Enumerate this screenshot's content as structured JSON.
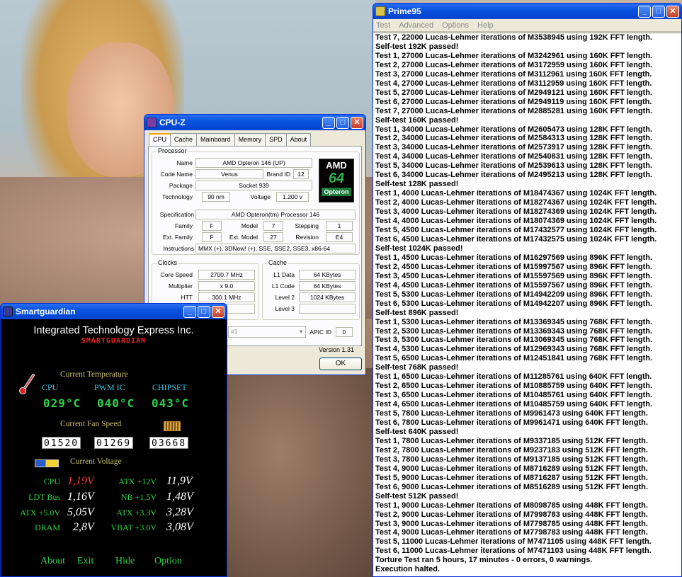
{
  "prime95": {
    "title": "Prime95",
    "menu": [
      "Test",
      "Advanced",
      "Options",
      "Help"
    ],
    "lines": [
      "Test 7, 22000 Lucas-Lehmer iterations of M3538945 using 192K FFT length.",
      "Self-test 192K passed!",
      "Test 1, 27000 Lucas-Lehmer iterations of M3242961 using 160K FFT length.",
      "Test 2, 27000 Lucas-Lehmer iterations of M3172959 using 160K FFT length.",
      "Test 3, 27000 Lucas-Lehmer iterations of M3112961 using 160K FFT length.",
      "Test 4, 27000 Lucas-Lehmer iterations of M3112959 using 160K FFT length.",
      "Test 5, 27000 Lucas-Lehmer iterations of M2949121 using 160K FFT length.",
      "Test 6, 27000 Lucas-Lehmer iterations of M2949119 using 160K FFT length.",
      "Test 7, 27000 Lucas-Lehmer iterations of M2885281 using 160K FFT length.",
      "Self-test 160K passed!",
      "Test 1, 34000 Lucas-Lehmer iterations of M2605473 using 128K FFT length.",
      "Test 2, 34000 Lucas-Lehmer iterations of M2584313 using 128K FFT length.",
      "Test 3, 34000 Lucas-Lehmer iterations of M2573917 using 128K FFT length.",
      "Test 4, 34000 Lucas-Lehmer iterations of M2540831 using 128K FFT length.",
      "Test 5, 34000 Lucas-Lehmer iterations of M2539613 using 128K FFT length.",
      "Test 6, 34000 Lucas-Lehmer iterations of M2495213 using 128K FFT length.",
      "Self-test 128K passed!",
      "Test 1, 4000 Lucas-Lehmer iterations of M18474367 using 1024K FFT length.",
      "Test 2, 4000 Lucas-Lehmer iterations of M18274367 using 1024K FFT length.",
      "Test 3, 4000 Lucas-Lehmer iterations of M18274369 using 1024K FFT length.",
      "Test 4, 4000 Lucas-Lehmer iterations of M18074369 using 1024K FFT length.",
      "Test 5, 4500 Lucas-Lehmer iterations of M17432577 using 1024K FFT length.",
      "Test 6, 4500 Lucas-Lehmer iterations of M17432575 using 1024K FFT length.",
      "Self-test 1024K passed!",
      "Test 1, 4500 Lucas-Lehmer iterations of M16297569 using 896K FFT length.",
      "Test 2, 4500 Lucas-Lehmer iterations of M15997567 using 896K FFT length.",
      "Test 3, 4500 Lucas-Lehmer iterations of M15597569 using 896K FFT length.",
      "Test 4, 4500 Lucas-Lehmer iterations of M15597567 using 896K FFT length.",
      "Test 5, 5300 Lucas-Lehmer iterations of M14942209 using 896K FFT length.",
      "Test 6, 5300 Lucas-Lehmer iterations of M14942207 using 896K FFT length.",
      "Self-test 896K passed!",
      "Test 1, 5300 Lucas-Lehmer iterations of M13369345 using 768K FFT length.",
      "Test 2, 5300 Lucas-Lehmer iterations of M13369343 using 768K FFT length.",
      "Test 3, 5300 Lucas-Lehmer iterations of M13069345 using 768K FFT length.",
      "Test 4, 5300 Lucas-Lehmer iterations of M12969343 using 768K FFT length.",
      "Test 5, 6500 Lucas-Lehmer iterations of M12451841 using 768K FFT length.",
      "Self-test 768K passed!",
      "Test 1, 6500 Lucas-Lehmer iterations of M11285761 using 640K FFT length.",
      "Test 2, 6500 Lucas-Lehmer iterations of M10885759 using 640K FFT length.",
      "Test 3, 6500 Lucas-Lehmer iterations of M10485761 using 640K FFT length.",
      "Test 4, 6500 Lucas-Lehmer iterations of M10485759 using 640K FFT length.",
      "Test 5, 7800 Lucas-Lehmer iterations of M9961473 using 640K FFT length.",
      "Test 6, 7800 Lucas-Lehmer iterations of M9961471 using 640K FFT length.",
      "Self-test 640K passed!",
      "Test 1, 7800 Lucas-Lehmer iterations of M9337185 using 512K FFT length.",
      "Test 2, 7800 Lucas-Lehmer iterations of M9237183 using 512K FFT length.",
      "Test 3, 7800 Lucas-Lehmer iterations of M9137185 using 512K FFT length.",
      "Test 4, 9000 Lucas-Lehmer iterations of M8716289 using 512K FFT length.",
      "Test 5, 9000 Lucas-Lehmer iterations of M8716287 using 512K FFT length.",
      "Test 6, 9000 Lucas-Lehmer iterations of M8516289 using 512K FFT length.",
      "Self-test 512K passed!",
      "Test 1, 9000 Lucas-Lehmer iterations of M8098785 using 448K FFT length.",
      "Test 2, 9000 Lucas-Lehmer iterations of M7998783 using 448K FFT length.",
      "Test 3, 9000 Lucas-Lehmer iterations of M7798785 using 448K FFT length.",
      "Test 4, 9000 Lucas-Lehmer iterations of M7798783 using 448K FFT length.",
      "Test 5, 11000 Lucas-Lehmer iterations of M7471105 using 448K FFT length.",
      "Test 6, 11000 Lucas-Lehmer iterations of M7471103 using 448K FFT length.",
      "Torture Test ran 5 hours, 17 minutes - 0 errors, 0 warnings.",
      "Execution halted."
    ]
  },
  "cpuz": {
    "title": "CPU-Z",
    "tabs": [
      "CPU",
      "Cache",
      "Mainboard",
      "Memory",
      "SPD",
      "About"
    ],
    "processor_group": "Processor",
    "name_label": "Name",
    "name": "AMD Opteron 146 (UP)",
    "codename_label": "Code Name",
    "codename": "Venus",
    "brandid_label": "Brand ID",
    "brandid": "12",
    "package_label": "Package",
    "package": "Socket 939",
    "technology_label": "Technology",
    "technology": "90 nm",
    "voltage_label": "Voltage",
    "voltage": "1.200 v",
    "spec_label": "Specification",
    "spec": "AMD Opteron(tm) Processor 146",
    "family_label": "Family",
    "family": "F",
    "model_label": "Model",
    "model": "7",
    "stepping_label": "Stepping",
    "stepping": "1",
    "extfamily_label": "Ext. Family",
    "extfamily": "F",
    "extmodel_label": "Ext. Model",
    "extmodel": "27",
    "revision_label": "Revision",
    "revision": "E4",
    "instructions_label": "Instructions",
    "instructions": "MMX (+), 3DNow! (+), SSE, SSE2, SSE3, x86-64",
    "logo": {
      "amd": "AMD",
      "num": "64",
      "line": "Opteron"
    },
    "clocks_group": "Clocks",
    "corespeed_label": "Core Speed",
    "corespeed": "2700.7 MHz",
    "multiplier_label": "Multiplier",
    "multiplier": "x 9.0",
    "htt_label": "HTT",
    "htt": "300.1 MHz",
    "cache_group": "Cache",
    "l1data_label": "L1 Data",
    "l1data": "64 KBytes",
    "l1code_label": "L1 Code",
    "l1code": "64 KBytes",
    "level2_label": "Level 2",
    "level2": "1024 KBytes",
    "level3_label": "Level 3",
    "selection": "#1",
    "apicid_label": "APIC ID",
    "apicid": "0",
    "version": "Version 1.31",
    "ok": "OK"
  },
  "smartguardian": {
    "title": "Smartguardian",
    "company": "Integrated Technology Express Inc.",
    "brand": "SMARTGUARDIAN",
    "temp_title": "Current Temperature",
    "temp_cols": [
      "CPU",
      "PWM IC",
      "CHIPSET"
    ],
    "temps": [
      "029°C",
      "040°C",
      "043°C"
    ],
    "fan_title": "Current Fan Speed",
    "fans": [
      "01520",
      "01269",
      "03668"
    ],
    "volt_title": "Current Voltage",
    "volts": [
      {
        "label": "CPU",
        "value": "1,19V"
      },
      {
        "label": "ATX +12V",
        "value": "11,9V"
      },
      {
        "label": "LDT Bus",
        "value": "1,16V"
      },
      {
        "label": "NB +1.5V",
        "value": "1,48V"
      },
      {
        "label": "ATX +5.0V",
        "value": "5,05V"
      },
      {
        "label": "ATX +3.3V",
        "value": "3,28V"
      },
      {
        "label": "DRAM",
        "value": "2,8V"
      },
      {
        "label": "VBAT +3.0V",
        "value": "3,08V"
      }
    ],
    "buttons": [
      "About",
      "Exit",
      "Hide",
      "Option"
    ],
    "colors": {
      "digits": "#2fd04a",
      "alert": "#e83a3a",
      "heading": "#c9c070",
      "column": "#3ec6e8"
    }
  }
}
